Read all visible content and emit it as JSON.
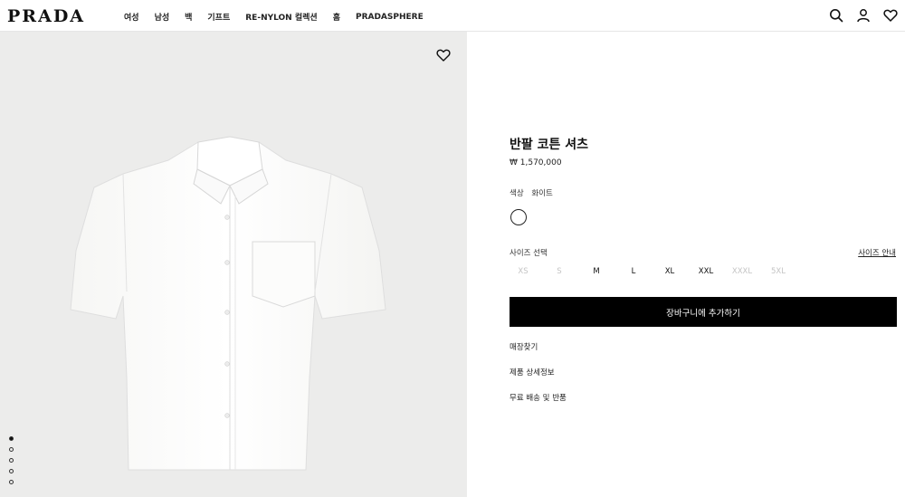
{
  "header": {
    "logo": "PRADA",
    "nav": [
      "여성",
      "남성",
      "백",
      "기프트",
      "RE-NYLON 컬렉션",
      "홈",
      "PRADASPHERE"
    ],
    "icons": [
      "search-icon",
      "account-icon",
      "wishlist-icon"
    ]
  },
  "gallery": {
    "image_alt": "white short-sleeve shirt",
    "dot_count": 5,
    "active_dot": 0
  },
  "product": {
    "title": "반팔 코튼 셔츠",
    "price": "₩ 1,570,000",
    "color_label": "색상",
    "color_value": "화이트",
    "swatch_color": "#ffffff",
    "size_label": "사이즈 선택",
    "size_guide": "사이즈 안내",
    "sizes": [
      {
        "label": "XS",
        "available": false
      },
      {
        "label": "S",
        "available": false
      },
      {
        "label": "M",
        "available": true
      },
      {
        "label": "L",
        "available": true
      },
      {
        "label": "XL",
        "available": true
      },
      {
        "label": "XXL",
        "available": true
      },
      {
        "label": "XXXL",
        "available": false
      },
      {
        "label": "5XL",
        "available": false
      }
    ],
    "add_to_cart": "장바구니에 추가하기",
    "links": [
      "매장찾기",
      "제품 상세정보",
      "무료 배송 및 반품"
    ]
  },
  "colors": {
    "accent": "#000000",
    "gallery_bg": "#ececeb",
    "unavailable": "#c4c4c4"
  }
}
